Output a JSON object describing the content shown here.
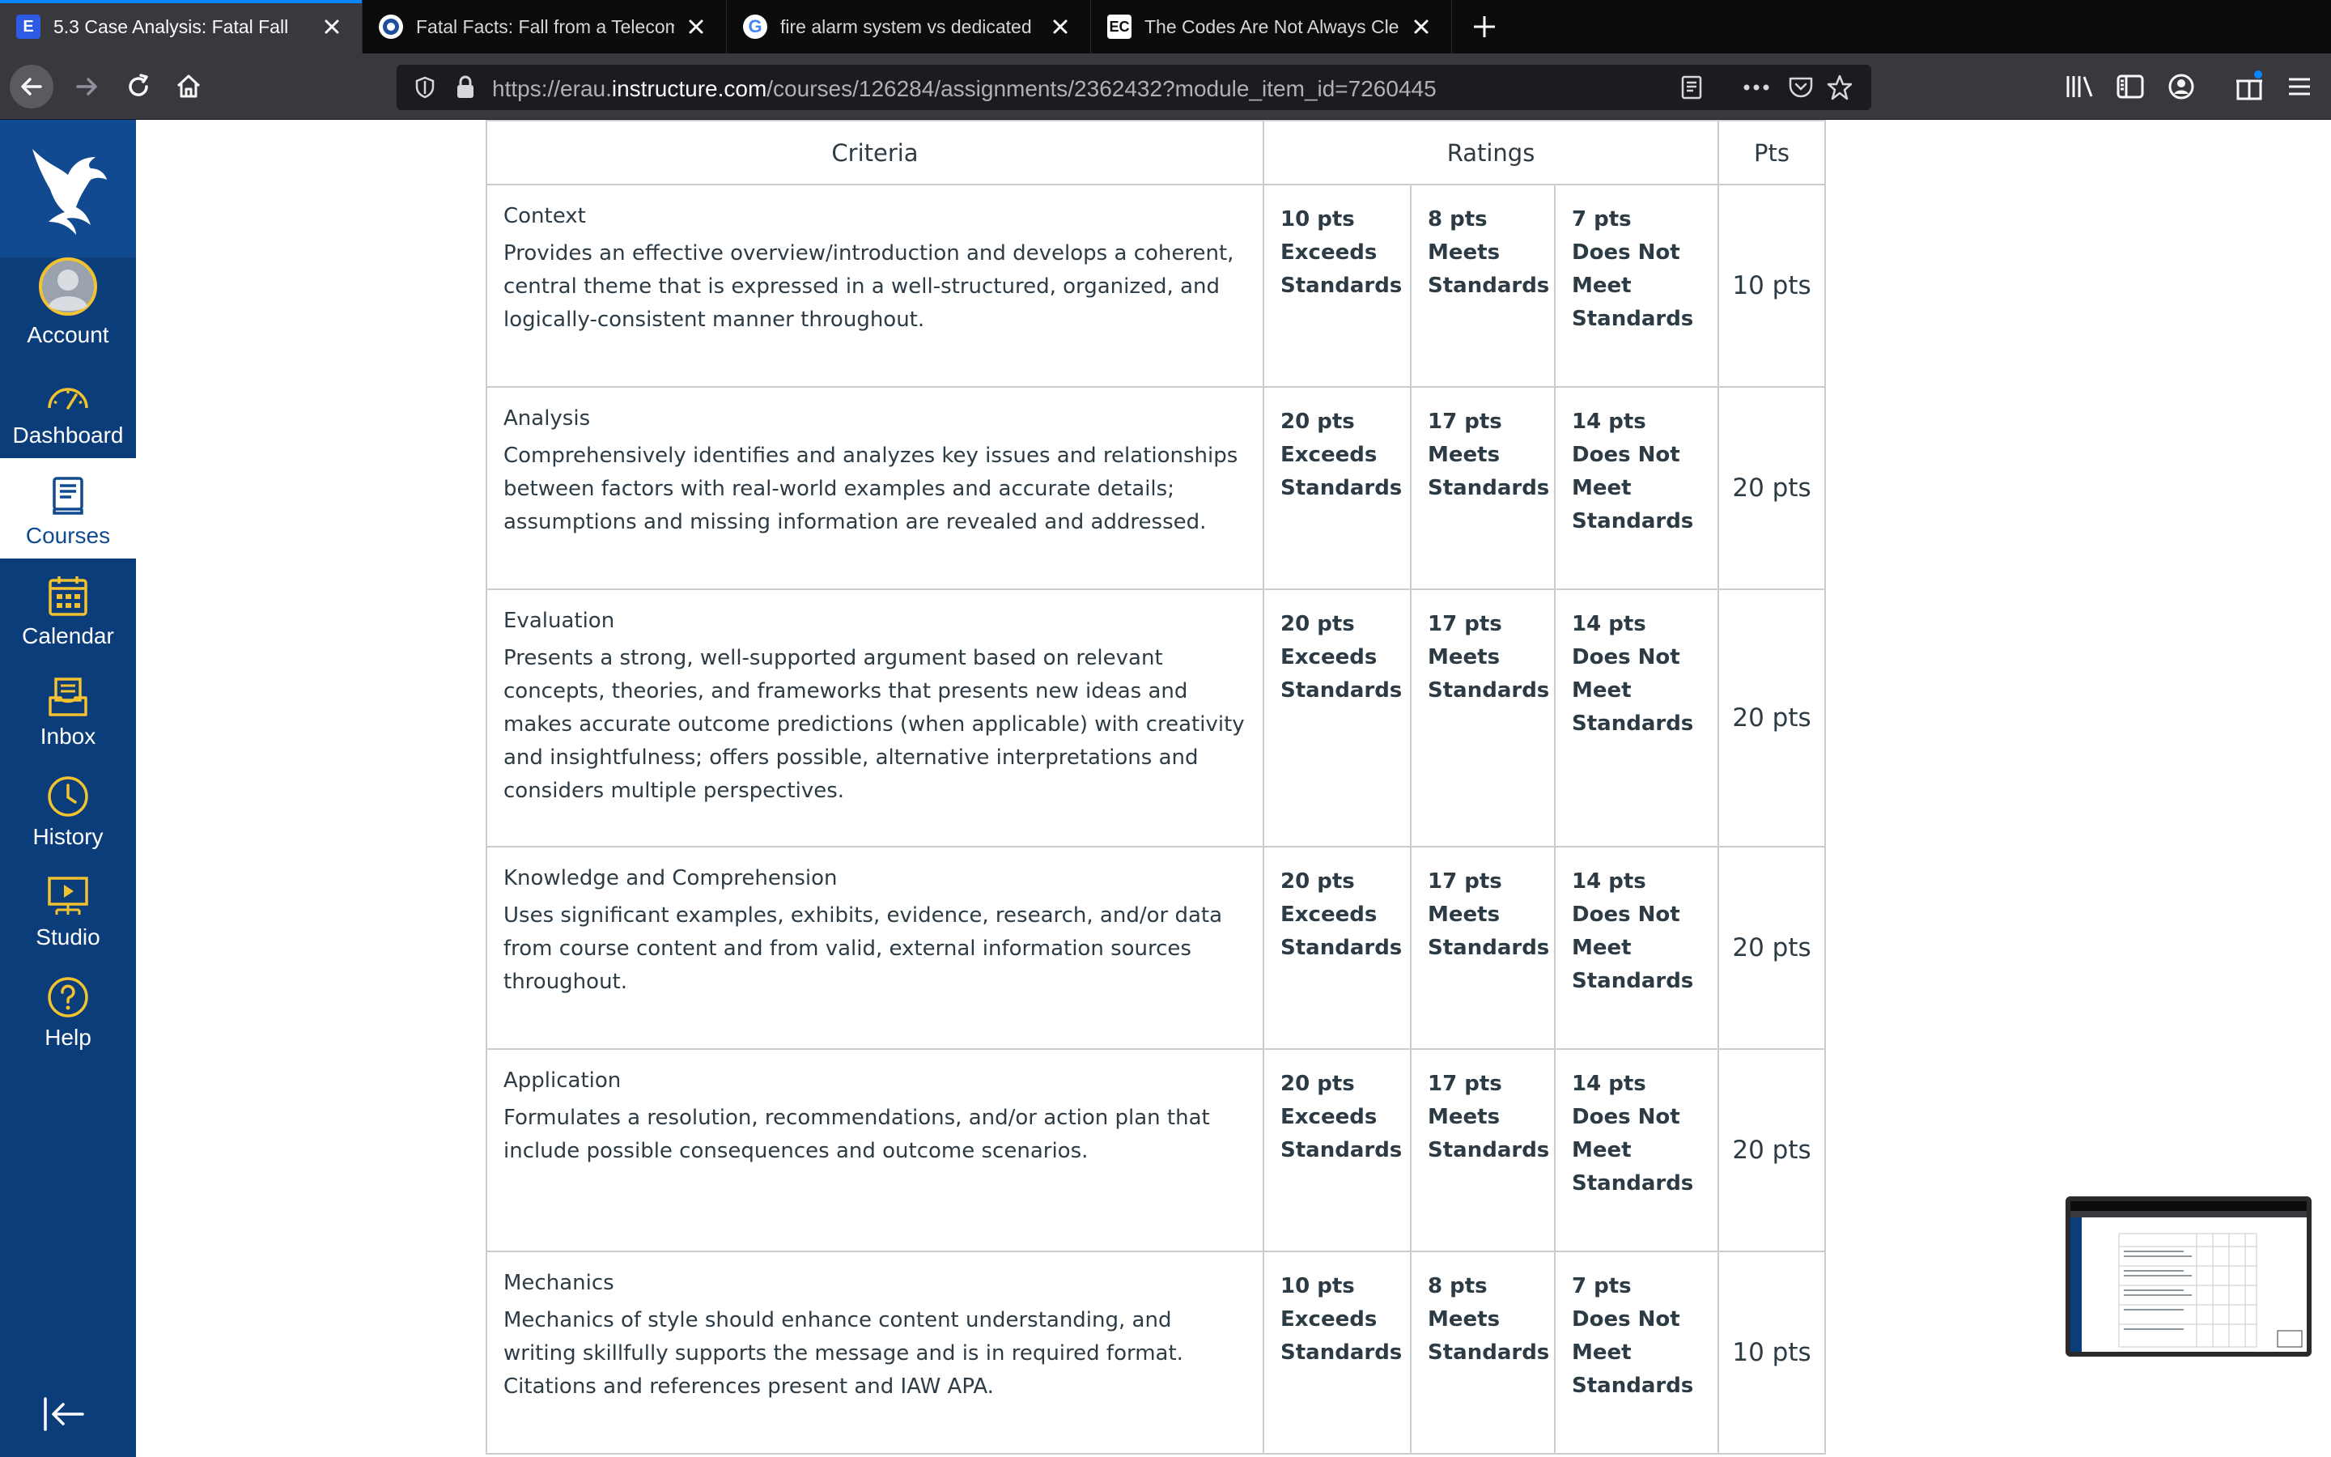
{
  "browser": {
    "tabs": [
      {
        "title": "5.3 Case Analysis: Fatal Fall",
        "favicon": "E",
        "active": true
      },
      {
        "title": "Fatal Facts: Fall from a Telecom",
        "favicon": "osha",
        "active": false
      },
      {
        "title": "fire alarm system vs dedicated",
        "favicon": "G",
        "active": false
      },
      {
        "title": "The Codes Are Not Always Clea",
        "favicon": "EC",
        "active": false
      }
    ],
    "url_prefix": "https://erau.",
    "url_domain": "instructure.com",
    "url_path": "/courses/126284/assignments/2362432?module_item_id=7260445"
  },
  "sidebar": {
    "items": [
      {
        "label": "Account",
        "icon": "account-avatar-icon"
      },
      {
        "label": "Dashboard",
        "icon": "dashboard-gauge-icon"
      },
      {
        "label": "Courses",
        "icon": "courses-book-icon"
      },
      {
        "label": "Calendar",
        "icon": "calendar-icon"
      },
      {
        "label": "Inbox",
        "icon": "inbox-icon"
      },
      {
        "label": "History",
        "icon": "history-clock-icon"
      },
      {
        "label": "Studio",
        "icon": "studio-icon"
      },
      {
        "label": "Help",
        "icon": "help-icon"
      }
    ],
    "active": "Courses"
  },
  "rubric": {
    "headers": {
      "criteria": "Criteria",
      "ratings": "Ratings",
      "pts": "Pts"
    },
    "rows": [
      {
        "name": "Context",
        "desc": "Provides an effective overview/introduction and develops a coherent, central theme that is expressed in a well-structured, organized, and logically-consistent manner throughout.",
        "ratings": [
          {
            "pts": "10 pts",
            "label": "Exceeds Standards"
          },
          {
            "pts": "8 pts",
            "label": "Meets Standards"
          },
          {
            "pts": "7 pts",
            "label": "Does Not Meet Standards"
          }
        ],
        "total": "10 pts"
      },
      {
        "name": "Analysis",
        "desc": "Comprehensively identifies and analyzes key issues and relationships between factors with real-world examples and accurate details; assumptions and missing information are revealed and addressed.",
        "ratings": [
          {
            "pts": "20 pts",
            "label": "Exceeds Standards"
          },
          {
            "pts": "17 pts",
            "label": "Meets Standards"
          },
          {
            "pts": "14 pts",
            "label": "Does Not Meet Standards"
          }
        ],
        "total": "20 pts"
      },
      {
        "name": "Evaluation",
        "desc": "Presents a strong, well-supported argument based on relevant concepts, theories, and frameworks that presents new ideas and makes accurate outcome predictions (when applicable) with creativity and insightfulness; offers possible, alternative interpretations and considers multiple perspectives.",
        "ratings": [
          {
            "pts": "20 pts",
            "label": "Exceeds Standards"
          },
          {
            "pts": "17 pts",
            "label": "Meets Standards"
          },
          {
            "pts": "14 pts",
            "label": "Does Not Meet Standards"
          }
        ],
        "total": "20 pts"
      },
      {
        "name": "Knowledge and Comprehension",
        "desc": "Uses significant examples, exhibits, evidence, research, and/or data from course content and from valid, external information sources throughout.",
        "ratings": [
          {
            "pts": "20 pts",
            "label": "Exceeds Standards"
          },
          {
            "pts": "17 pts",
            "label": "Meets Standards"
          },
          {
            "pts": "14 pts",
            "label": "Does Not Meet Standards"
          }
        ],
        "total": "20 pts"
      },
      {
        "name": "Application",
        "desc": "Formulates a resolution, recommendations, and/or action plan that include possible consequences and outcome scenarios.",
        "ratings": [
          {
            "pts": "20 pts",
            "label": "Exceeds Standards"
          },
          {
            "pts": "17 pts",
            "label": "Meets Standards"
          },
          {
            "pts": "14 pts",
            "label": "Does Not Meet Standards"
          }
        ],
        "total": "20 pts"
      },
      {
        "name": "Mechanics",
        "desc": "Mechanics of style should enhance content understanding, and writing skillfully supports the message and is in required format. Citations and references present and IAW APA.",
        "ratings": [
          {
            "pts": "10 pts",
            "label": "Exceeds Standards"
          },
          {
            "pts": "8 pts",
            "label": "Meets Standards"
          },
          {
            "pts": "7 pts",
            "label": "Does Not Meet Standards"
          }
        ],
        "total": "10 pts"
      }
    ]
  },
  "colors": {
    "canvas_sidebar": "#0b3d7a",
    "accent_yellow": "#f2c230",
    "firefox_tab_accent": "#0a84ff"
  }
}
